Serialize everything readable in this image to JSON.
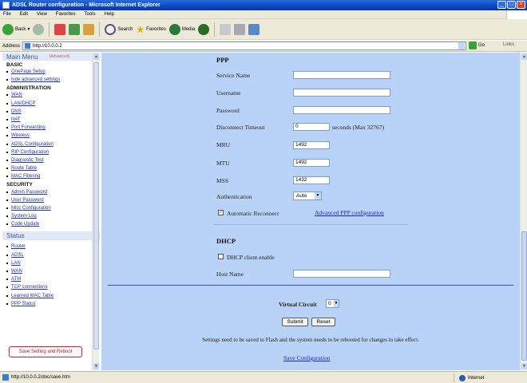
{
  "window": {
    "title": "ADSL Router configuration - Microsoft Internet Explorer"
  },
  "menubar": {
    "items": [
      "File",
      "Edit",
      "View",
      "Favorites",
      "Tools",
      "Help"
    ]
  },
  "toolbar": {
    "back": "Back",
    "search": "Search",
    "favorites": "Favorites",
    "media": "Media"
  },
  "address": {
    "label": "Address",
    "value": "http://10.0.0.2",
    "go": "Go",
    "links": "Links"
  },
  "sidebar": {
    "title": "Main Menu",
    "advanced": "(Advanced)",
    "basic_header": "BASIC",
    "basic": [
      "OnePage Setup",
      "hide advanced settings"
    ],
    "admin_header": "ADMINISTRATION",
    "admin": [
      "WAN",
      "LAN/DHCP",
      "DNS",
      "NAT",
      "Port Forwarding",
      "Wireless",
      "ADSL Configuration",
      "RIP Configuration",
      "Diagnostic Test",
      "Route Table",
      "MAC Filtering"
    ],
    "security_header": "SECURITY",
    "security": [
      "Admin Password",
      "User Password",
      "Misc Configuration",
      "System Log",
      "Code Update"
    ],
    "status_header": "Status",
    "status": [
      "Router",
      "ADSL",
      "LAN",
      "WAN",
      "ATM",
      "TCP connections",
      "Learned MAC Table",
      "PPP Status"
    ],
    "save_reboot": "Save Setting and Reboot"
  },
  "ppp": {
    "header": "PPP",
    "service_name_label": "Service Name",
    "service_name": "",
    "username_label": "Username",
    "username": "",
    "password_label": "Password",
    "password": "",
    "disconnect_label": "Disconnect Timeout",
    "disconnect_value": "0",
    "disconnect_unit": "seconds (Max 32767)",
    "mru_label": "MRU",
    "mru": "1492",
    "mtu_label": "MTU",
    "mtu": "1492",
    "mss_label": "MSS",
    "mss": "1432",
    "auth_label": "Authentication",
    "auth_value": "Auto",
    "auto_reconnect_label": "Automatic Reconnect",
    "auto_reconnect_checked": true,
    "advanced_link": "Advanced PPP configuration"
  },
  "dhcp": {
    "header": "DHCP",
    "client_enable_label": "DHCP client enable",
    "client_enable_checked": false,
    "host_name_label": "Host Name",
    "host_name": ""
  },
  "footer": {
    "virtual_circuit_label": "Virtual Circuit",
    "virtual_circuit_value": "0",
    "submit": "Submit",
    "reset": "Reset",
    "note": "Settings need to be saved to Flash and the system needs to be rebooted for changes to take effect.",
    "save_link": "Save Configuration"
  },
  "statusbar": {
    "url": "http://10.0.0.2/doc/save.htm",
    "zone": "Internet"
  },
  "colors": {
    "content_bg": "#b8d2f8",
    "titlebar": "#0a46c4",
    "link": "#2222cc"
  }
}
